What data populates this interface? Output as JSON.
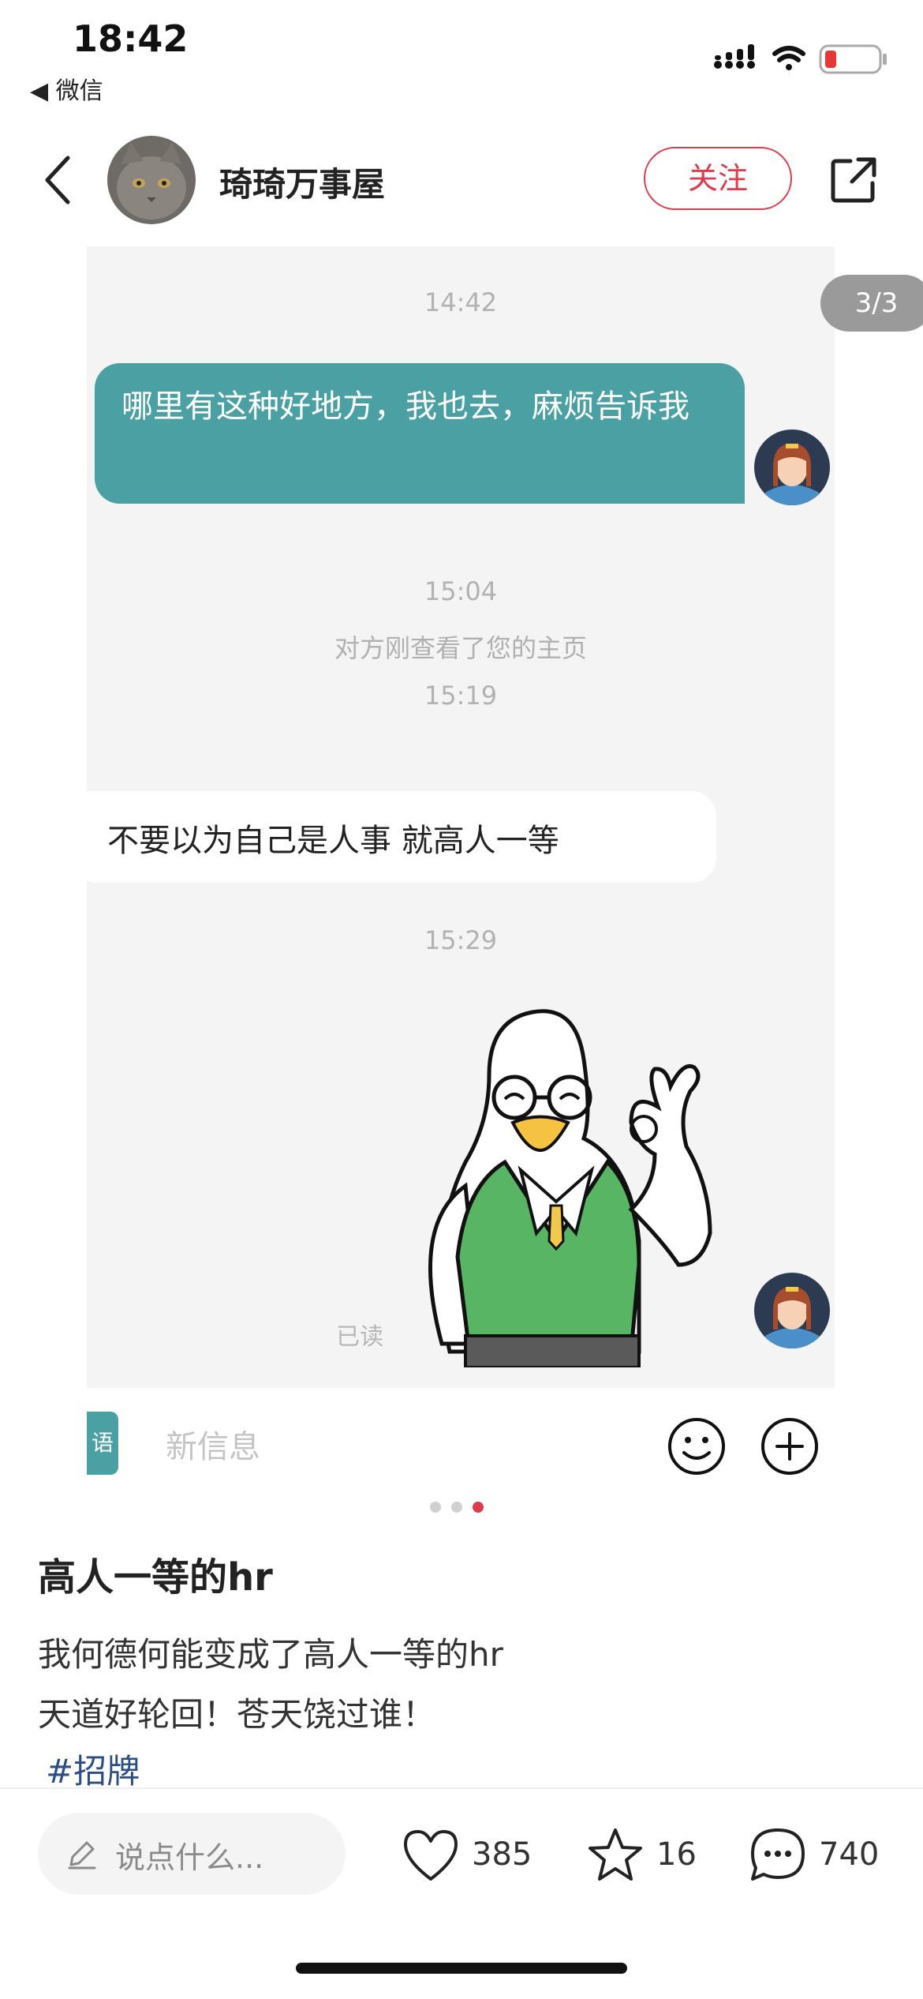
{
  "status_bar": {
    "time": "18:42",
    "back_app": "◀ 微信"
  },
  "header": {
    "author": "琦琦万事屋",
    "follow_label": "关注"
  },
  "image_card": {
    "page_indicator": "3/3",
    "chat": {
      "timestamps": [
        "14:42",
        "15:04",
        "15:19",
        "15:29"
      ],
      "outgoing_message": "哪里有这种好地方，我也去，麻烦告诉我",
      "system_message": "对方刚查看了您的主页",
      "incoming_message": "不要以为自己是人事 就高人一等",
      "read_status": "已读",
      "input_placeholder": "新信息",
      "voice_label": "语"
    }
  },
  "post": {
    "title": "高人一等的hr",
    "lines": [
      "我何德何能变成了高人一等的hr",
      "天道好轮回！苍天饶过谁！"
    ],
    "hashtag": "#招牌"
  },
  "bottom_bar": {
    "comment_placeholder": "说点什么...",
    "likes": "385",
    "favorites": "16",
    "comments": "740"
  },
  "colors": {
    "accent_red": "#e03b4c",
    "bubble_teal": "#4aa0a2",
    "hashtag_blue": "#2c4e86"
  }
}
